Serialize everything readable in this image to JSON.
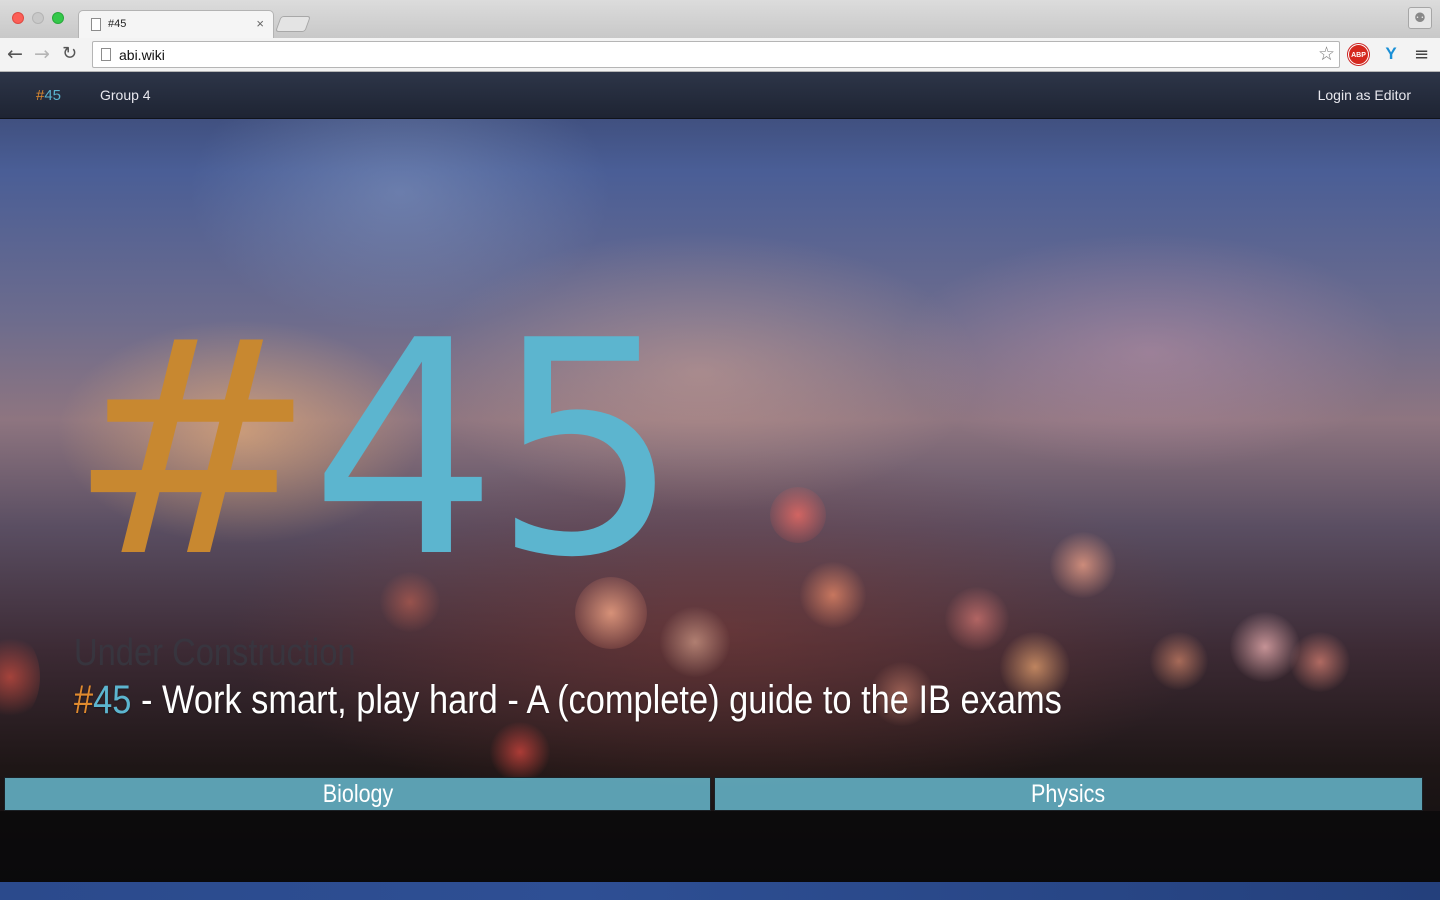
{
  "browser": {
    "tab_title": "#45",
    "tab_close": "×",
    "url": "abi.wiki",
    "nav": {
      "back": "←",
      "forward": "→",
      "reload": "↻",
      "bookmark": "☆",
      "menu": "≡"
    },
    "extensions": {
      "adblock": "ABP",
      "ext2": "Y"
    }
  },
  "navbar": {
    "brand_hash": "#",
    "brand_num": "45",
    "links": [
      "Group 4"
    ],
    "login": "Login as Editor"
  },
  "hero": {
    "hash": "#",
    "num": "45",
    "status": "Under Construction",
    "tagline_hash": "#",
    "tagline_num": "45",
    "tagline_text": " - Work smart, play hard - A (complete) guide to the IB exams"
  },
  "subjects": [
    "Biology",
    "Physics"
  ],
  "colors": {
    "accent_orange": "#e08a2e",
    "accent_blue": "#5cb5cf",
    "subject_bar": "#62acc0",
    "navbar": "#252b3c"
  }
}
